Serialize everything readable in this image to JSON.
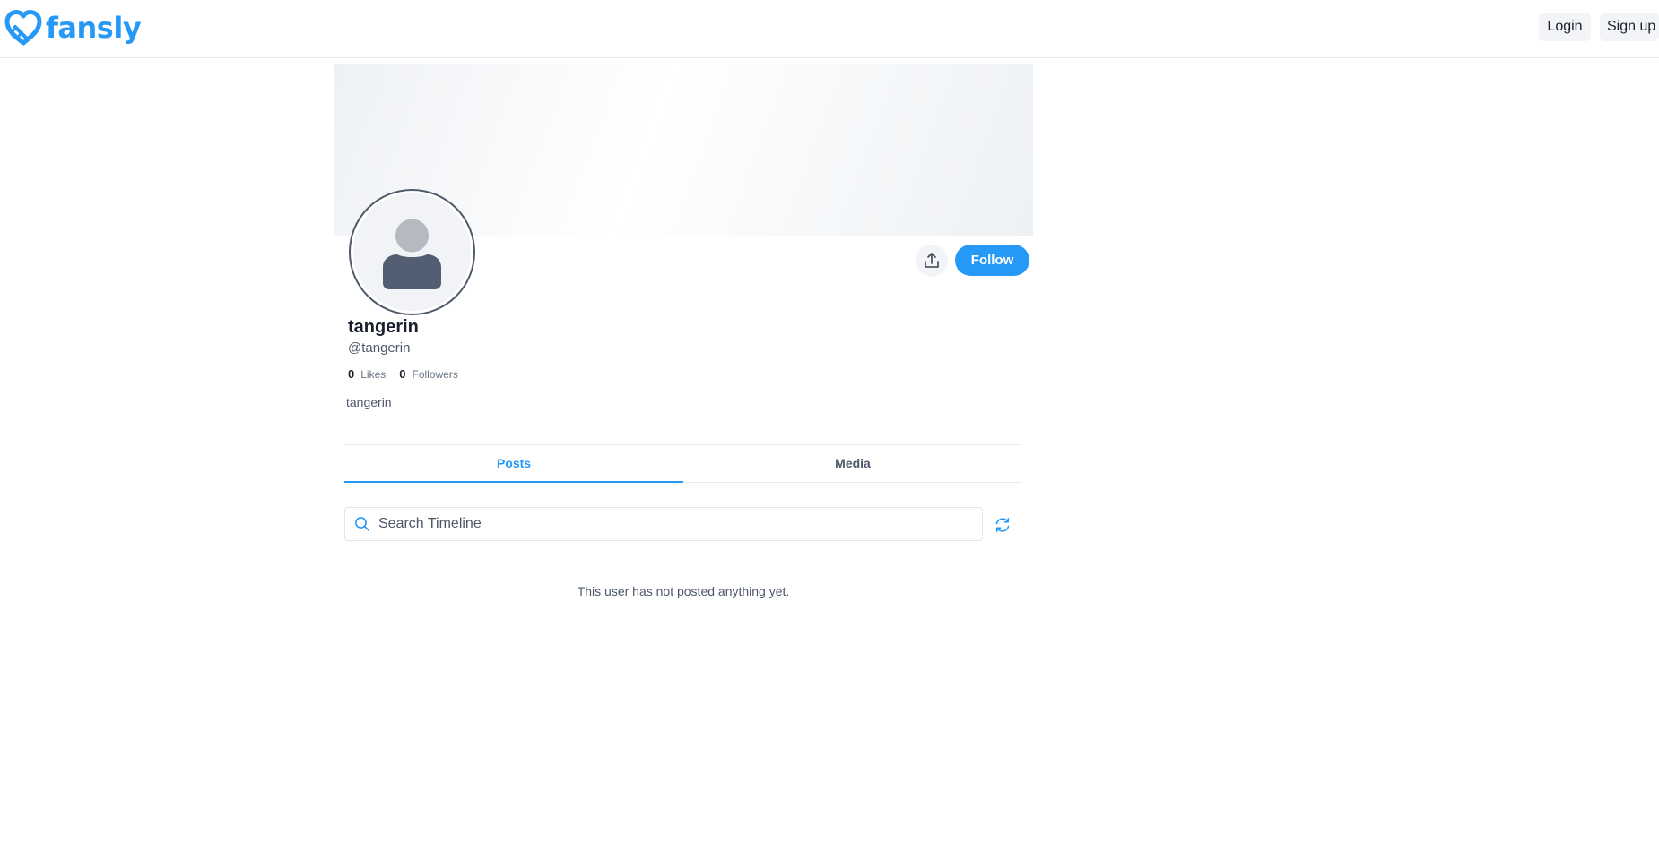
{
  "brand": {
    "name": "fansly",
    "logo_icon": "heart-lock-logo-icon",
    "color": "#2699f7"
  },
  "header": {
    "login_label": "Login",
    "signup_label": "Sign up"
  },
  "profile": {
    "display_name": "tangerin",
    "username": "@tangerin",
    "likes_count": "0",
    "likes_label": "Likes",
    "followers_count": "0",
    "followers_label": "Followers",
    "bio": "tangerin",
    "avatar_icon": "default-user-avatar-icon",
    "share_icon": "share-upload-icon",
    "follow_label": "Follow"
  },
  "tabs": [
    {
      "label": "Posts",
      "active": true
    },
    {
      "label": "Media",
      "active": false
    }
  ],
  "timeline": {
    "search_placeholder": "Search Timeline",
    "search_value": "",
    "search_icon": "search-icon",
    "refresh_icon": "refresh-icon",
    "empty_message": "This user has not posted anything yet."
  },
  "colors": {
    "accent": "#2699f7",
    "text_primary": "#1a1f2e",
    "text_secondary": "#4d5869",
    "border": "#e7eaee"
  }
}
